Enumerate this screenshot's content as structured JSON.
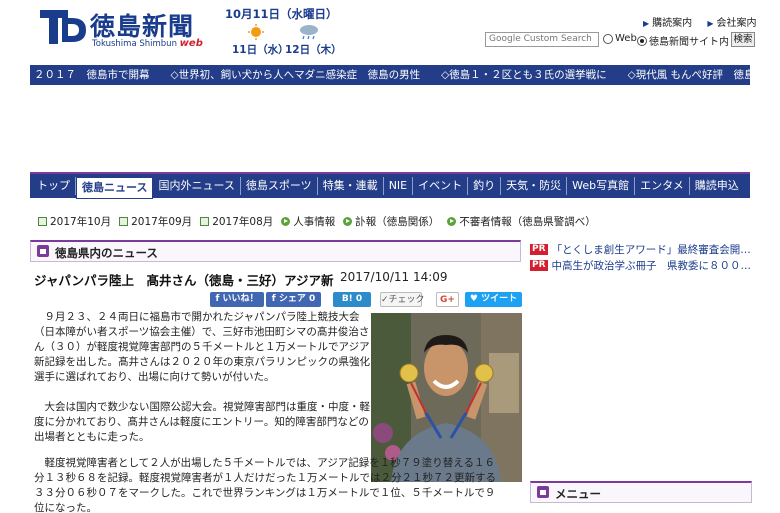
{
  "header": {
    "logo_title": "徳島新聞",
    "logo_sub": "Tokushima Shimbun",
    "logo_web": "web",
    "date": "10月11日（水曜日）",
    "weather": [
      {
        "day": "11日（水）",
        "icon": "sun-icon"
      },
      {
        "day": "12日（木）",
        "icon": "cloud-rain-icon"
      }
    ],
    "links": [
      "購読案内",
      "会社案内"
    ],
    "search": {
      "placeholder": "Google  Custom Search",
      "options": [
        "Web",
        "徳島新聞サイト内"
      ],
      "selected": "徳島新聞サイト内",
      "button": "検索"
    }
  },
  "ticker": "２０１７　徳島市で開幕　　◇世界初、飼い犬から人へマダニ感染症　徳島の男性　　◇徳島１・２区とも３氏の選挙戦に　　◇現代風 もんぺ好評　徳島・勝浦の大統",
  "nav": {
    "items": [
      "トップ",
      "徳島ニュース",
      "国内外ニュース",
      "徳島スポーツ",
      "特集・連載",
      "NIE",
      "イベント",
      "釣り",
      "天気・防災",
      "Web写真館",
      "エンタメ",
      "購読申込"
    ],
    "active": "徳島ニュース"
  },
  "sublinks": [
    {
      "label": "2017年10月",
      "icon": "document-icon"
    },
    {
      "label": "2017年09月",
      "icon": "document-icon"
    },
    {
      "label": "2017年08月",
      "icon": "document-icon"
    },
    {
      "label": "人事情報",
      "icon": "arrow-circle-icon"
    },
    {
      "label": "訃報（徳島関係）",
      "icon": "arrow-circle-icon"
    },
    {
      "label": "不審者情報（徳島県警調べ）",
      "icon": "arrow-circle-icon"
    }
  ],
  "section_title": "徳島県内のニュース",
  "article": {
    "title": "ジャパンパラ陸上　髙井さん（徳島・三好）アジア新",
    "datetime": "2017/10/11 14:09",
    "paragraphs": [
      "９月２３、２４両日に福島市で開かれたジャパンパラ陸上競技大会（日本障がい者スポーツ協会主催）で、三好市池田町シマの髙井俊治さん（３０）が軽度視覚障害部門の５千メートルと１万メートルでアジア新記録を出した。髙井さんは２０２０年の東京パラリンピックの県強化選手に選ばれており、出場に向けて勢いが付いた。",
      "大会は国内で数少ない国際公認大会。視覚障害部門は重度・中度・軽度に分かれており、髙井さんは軽度にエントリー。知的障害部門などの出場者とともに走った。",
      "軽度視覚障害者として２人が出場した５千メートルでは、アジア記録を１秒７９塗り替える１６分１３秒６８を記録。軽度視覚障害者が１人だけだった１万メートルでは２分２１秒７２更新する３３分０６秒０７をマークした。これで世界ランキングは１万メートルで１位、５千メートルで９位になった。"
    ]
  },
  "social": {
    "like": "いいね！",
    "share": "シェア 0",
    "hatena": "0",
    "check": "チェック",
    "gplus": "G+",
    "tweet": "ツイート"
  },
  "right_column": {
    "pr": [
      {
        "tag": "PR",
        "text": "「とくしま創生アワード」最終審査会開…"
      },
      {
        "tag": "PR",
        "text": "中高生が政治学ぶ冊子　県教委に８００…"
      }
    ],
    "menu_title": "メニュー"
  },
  "colors": {
    "brand_blue": "#233d88",
    "accent_purple": "#7c3a9a",
    "pr_red": "#d31f2f"
  }
}
